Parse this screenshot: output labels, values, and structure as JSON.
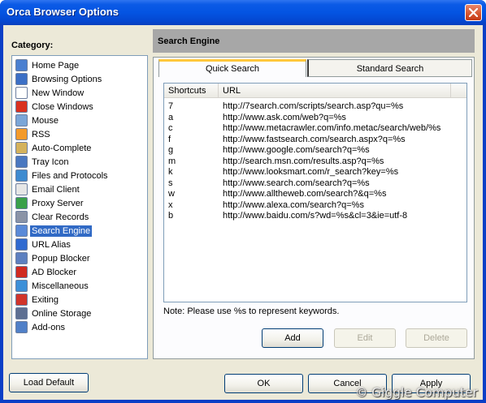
{
  "window": {
    "title": "Orca Browser Options"
  },
  "category": {
    "label": "Category:",
    "items": [
      {
        "label": "Home Page",
        "icon": "home-page-icon",
        "color": "#4a7fd0"
      },
      {
        "label": "Browsing Options",
        "icon": "browsing-options-icon",
        "color": "#3b6fc6"
      },
      {
        "label": "New Window",
        "icon": "new-window-icon",
        "color": "#ffffff"
      },
      {
        "label": "Close Windows",
        "icon": "close-windows-icon",
        "color": "#d9311f"
      },
      {
        "label": "Mouse",
        "icon": "mouse-icon",
        "color": "#7aa6d8"
      },
      {
        "label": "RSS",
        "icon": "rss-icon",
        "color": "#f39a2a"
      },
      {
        "label": "Auto-Complete",
        "icon": "auto-complete-icon",
        "color": "#d4b25c"
      },
      {
        "label": "Tray Icon",
        "icon": "tray-icon",
        "color": "#4a78c0"
      },
      {
        "label": "Files and Protocols",
        "icon": "files-protocols-icon",
        "color": "#3d8ad0"
      },
      {
        "label": "Email Client",
        "icon": "email-client-icon",
        "color": "#e6e6e6"
      },
      {
        "label": "Proxy Server",
        "icon": "proxy-server-icon",
        "color": "#3aa04a"
      },
      {
        "label": "Clear Records",
        "icon": "clear-records-icon",
        "color": "#8a93a6"
      },
      {
        "label": "Search Engine",
        "icon": "search-engine-icon",
        "color": "#5a8ad8",
        "selected": true
      },
      {
        "label": "URL Alias",
        "icon": "url-alias-icon",
        "color": "#2f6ad0"
      },
      {
        "label": "Popup Blocker",
        "icon": "popup-blocker-icon",
        "color": "#5d80c0"
      },
      {
        "label": "AD Blocker",
        "icon": "ad-blocker-icon",
        "color": "#d02a20"
      },
      {
        "label": "Miscellaneous",
        "icon": "miscellaneous-icon",
        "color": "#3c8fd8"
      },
      {
        "label": "Exiting",
        "icon": "exiting-icon",
        "color": "#d0342a"
      },
      {
        "label": "Online Storage",
        "icon": "online-storage-icon",
        "color": "#5d6f92"
      },
      {
        "label": "Add-ons",
        "icon": "add-ons-icon",
        "color": "#5080c8"
      }
    ]
  },
  "section": {
    "title": "Search Engine"
  },
  "tabs": [
    {
      "label": "Quick Search",
      "active": true
    },
    {
      "label": "Standard Search",
      "active": false
    }
  ],
  "table": {
    "columns": [
      "Shortcuts",
      "URL"
    ],
    "rows": [
      {
        "shortcut": "7",
        "url": "http://7search.com/scripts/search.asp?qu=%s"
      },
      {
        "shortcut": "a",
        "url": "http://www.ask.com/web?q=%s"
      },
      {
        "shortcut": "c",
        "url": "http://www.metacrawler.com/info.metac/search/web/%s"
      },
      {
        "shortcut": "f",
        "url": "http://www.fastsearch.com/search.aspx?q=%s"
      },
      {
        "shortcut": "g",
        "url": "http://www.google.com/search?q=%s"
      },
      {
        "shortcut": "m",
        "url": "http://search.msn.com/results.asp?q=%s"
      },
      {
        "shortcut": "k",
        "url": "http://www.looksmart.com/r_search?key=%s"
      },
      {
        "shortcut": "s",
        "url": "http://www.search.com/search?q=%s"
      },
      {
        "shortcut": "w",
        "url": "http://www.alltheweb.com/search?&q=%s"
      },
      {
        "shortcut": "x",
        "url": "http://www.alexa.com/search?q=%s"
      },
      {
        "shortcut": "b",
        "url": "http://www.baidu.com/s?wd=%s&cl=3&ie=utf-8"
      }
    ]
  },
  "note": "Note: Please use %s to represent keywords.",
  "buttons": {
    "add": "Add",
    "edit": "Edit",
    "delete": "Delete",
    "load_default": "Load Default",
    "ok": "OK",
    "cancel": "Cancel",
    "apply": "Apply"
  },
  "watermark": "© Giggle Computer"
}
